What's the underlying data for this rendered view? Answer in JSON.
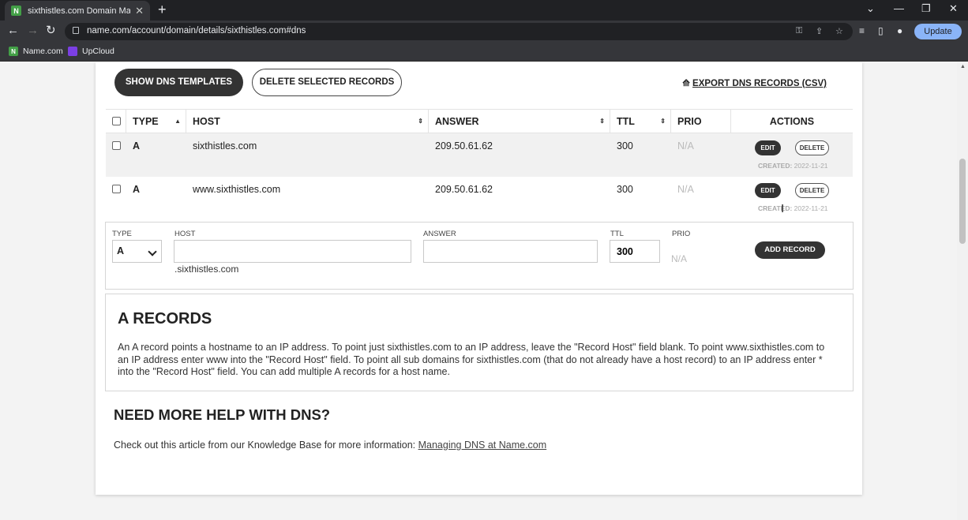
{
  "browser": {
    "tab_title": "sixthistles.com Domain Managem",
    "tab_favicon": "N",
    "url": "name.com/account/domain/details/sixthistles.com#dns",
    "update_label": "Update",
    "bookmarks": [
      {
        "label": "Name.com",
        "icon": "N",
        "color": "#43a047"
      },
      {
        "label": "UpCloud",
        "icon": "",
        "color": "#7b3fe4"
      }
    ]
  },
  "toolbar": {
    "show_templates": "SHOW DNS TEMPLATES",
    "delete_selected": "DELETE SELECTED RECORDS",
    "export": "EXPORT DNS RECORDS (CSV)"
  },
  "table": {
    "headers": {
      "type": "TYPE",
      "host": "HOST",
      "answer": "ANSWER",
      "ttl": "TTL",
      "prio": "PRIO",
      "actions": "ACTIONS"
    },
    "rows": [
      {
        "type": "A",
        "host": "sixthistles.com",
        "answer": "209.50.61.62",
        "ttl": "300",
        "prio": "N/A",
        "edit": "EDIT",
        "delete": "DELETE",
        "created_label": "CREATED:",
        "created_date": "2022-11-21"
      },
      {
        "type": "A",
        "host": "www.sixthistles.com",
        "answer": "209.50.61.62",
        "ttl": "300",
        "prio": "N/A",
        "edit": "EDIT",
        "delete": "DELETE",
        "created_label": "CREATED:",
        "created_date": "2022-11-21"
      }
    ]
  },
  "add_form": {
    "type_label": "TYPE",
    "type_value": "A",
    "host_label": "HOST",
    "host_value": "",
    "answer_label": "ANSWER",
    "answer_value": "",
    "ttl_label": "TTL",
    "ttl_value": "300",
    "prio_label": "PRIO",
    "prio_value": "N/A",
    "domain_suffix": ".sixthistles.com",
    "add_button": "ADD RECORD"
  },
  "info": {
    "title": "A RECORDS",
    "text": "An A record points a hostname to an IP address. To point just sixthistles.com to an IP address, leave the \"Record Host\" field blank. To point www.sixthistles.com to an IP address enter www into the \"Record Host\" field. To point all sub domains for sixthistles.com (that do not already have a host record) to an IP address enter * into the \"Record Host\" field. You can add multiple A records for a host name."
  },
  "help": {
    "title": "NEED MORE HELP WITH DNS?",
    "text": "Check out this article from our Knowledge Base for more information: ",
    "link": "Managing DNS at Name.com"
  }
}
